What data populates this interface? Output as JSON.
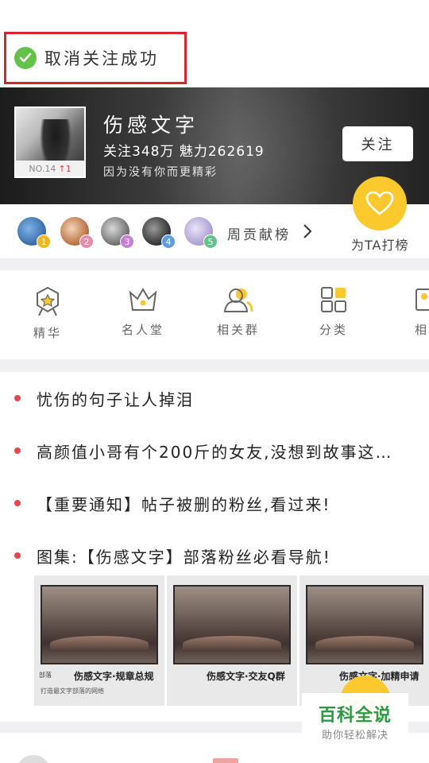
{
  "toast": {
    "text": "取消关注成功"
  },
  "forum": {
    "name": "伤感文字",
    "rank_label": "NO.14",
    "rank_change": "↑1",
    "stats": "关注348万 魅力262619",
    "slogan": "因为没有你而更精彩",
    "follow_label": "关注"
  },
  "fans": {
    "label": "周贡献榜",
    "cheer_label": "为TA打榜",
    "ranks": [
      "1",
      "2",
      "3",
      "4",
      "5"
    ]
  },
  "categories": [
    {
      "label": "精华",
      "icon": "medal-icon"
    },
    {
      "label": "名人堂",
      "icon": "crown-icon"
    },
    {
      "label": "相关群",
      "icon": "group-icon"
    },
    {
      "label": "分类",
      "icon": "grid-icon"
    },
    {
      "label": "相",
      "icon": "photo-icon"
    }
  ],
  "posts": [
    {
      "title": "忧伤的句子让人掉泪"
    },
    {
      "title": "高颜值小哥有个200斤的女友,没想到故事这…"
    },
    {
      "title": "【重要通知】帖子被删的粉丝,看过来!"
    },
    {
      "title": "图集:【伤感文字】部落粉丝必看导航!"
    }
  ],
  "thumbs": [
    {
      "caption": "伤感文字·规章总规",
      "tag": "部落",
      "small": "打造最文字部落的网络"
    },
    {
      "caption": "伤感文字·交友Q群",
      "tag": "",
      "small": ""
    },
    {
      "caption": "伤感文字·加精申请",
      "tag": "",
      "small": ""
    }
  ],
  "watermark": {
    "title": "百科全说",
    "sub": "助你轻松解决"
  },
  "colors": {
    "accent": "#fbc92d",
    "toast_border": "#d8242f",
    "check": "#62c24a",
    "dot": "#e04a4a"
  }
}
